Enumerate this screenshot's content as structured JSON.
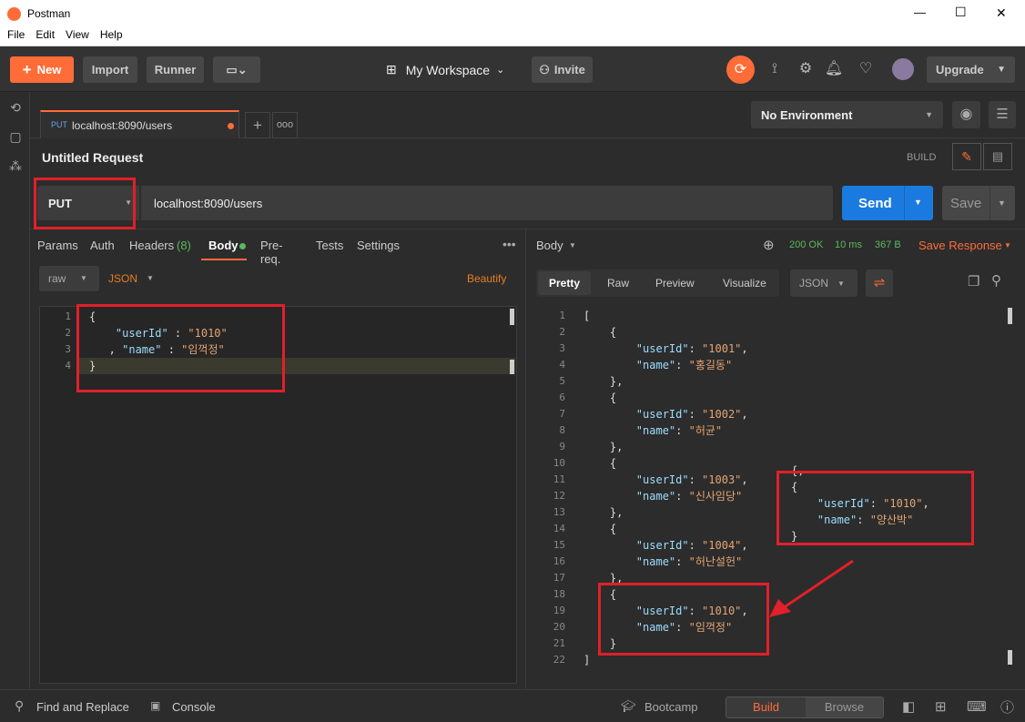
{
  "window": {
    "app_title": "Postman",
    "minimize": "—",
    "maximize": "☐",
    "close": "✕"
  },
  "menu": [
    "File",
    "Edit",
    "View",
    "Help"
  ],
  "header": {
    "new_label": "New",
    "import_label": "Import",
    "runner_label": "Runner",
    "workspace_label": "My Workspace",
    "invite_label": "Invite",
    "upgrade_label": "Upgrade"
  },
  "tab": {
    "method": "PUT",
    "url": "localhost:8090/users"
  },
  "environment": {
    "selected": "No Environment"
  },
  "request": {
    "title": "Untitled Request",
    "build_label": "BUILD",
    "method": "PUT",
    "url": "localhost:8090/users",
    "send_label": "Send",
    "save_label": "Save"
  },
  "request_tabs": {
    "params": "Params",
    "auth": "Auth",
    "headers": "Headers",
    "headers_count": "(8)",
    "body": "Body",
    "prereq": "Pre-req.",
    "tests": "Tests",
    "settings": "Settings"
  },
  "body_options": {
    "raw": "raw",
    "json": "JSON",
    "beautify": "Beautify"
  },
  "request_body": [
    {
      "n": "1",
      "parts": [
        [
          "p",
          "{"
        ]
      ]
    },
    {
      "n": "2",
      "parts": [
        [
          "p",
          "    "
        ],
        [
          "k",
          "\"userId\""
        ],
        [
          "p",
          " : "
        ],
        [
          "s",
          "\"1010\""
        ]
      ]
    },
    {
      "n": "3",
      "parts": [
        [
          "p",
          "   , "
        ],
        [
          "k",
          "\"name\""
        ],
        [
          "p",
          " : "
        ],
        [
          "s",
          "\"임꺽정\""
        ]
      ]
    },
    {
      "n": "4",
      "parts": [
        [
          "p",
          "}"
        ]
      ]
    }
  ],
  "response": {
    "body_label": "Body",
    "status": "200 OK",
    "time": "10 ms",
    "size": "367 B",
    "save_label": "Save Response",
    "views": {
      "pretty": "Pretty",
      "raw": "Raw",
      "preview": "Preview",
      "visualize": "Visualize"
    },
    "format": "JSON"
  },
  "response_body": [
    {
      "n": "1",
      "parts": [
        [
          "p",
          "["
        ]
      ]
    },
    {
      "n": "2",
      "parts": [
        [
          "p",
          "    {"
        ]
      ]
    },
    {
      "n": "3",
      "parts": [
        [
          "p",
          "        "
        ],
        [
          "k",
          "\"userId\""
        ],
        [
          "p",
          ": "
        ],
        [
          "s",
          "\"1001\""
        ],
        [
          "p",
          ","
        ]
      ]
    },
    {
      "n": "4",
      "parts": [
        [
          "p",
          "        "
        ],
        [
          "k",
          "\"name\""
        ],
        [
          "p",
          ": "
        ],
        [
          "s",
          "\"홍길동\""
        ]
      ]
    },
    {
      "n": "5",
      "parts": [
        [
          "p",
          "    },"
        ]
      ]
    },
    {
      "n": "6",
      "parts": [
        [
          "p",
          "    {"
        ]
      ]
    },
    {
      "n": "7",
      "parts": [
        [
          "p",
          "        "
        ],
        [
          "k",
          "\"userId\""
        ],
        [
          "p",
          ": "
        ],
        [
          "s",
          "\"1002\""
        ],
        [
          "p",
          ","
        ]
      ]
    },
    {
      "n": "8",
      "parts": [
        [
          "p",
          "        "
        ],
        [
          "k",
          "\"name\""
        ],
        [
          "p",
          ": "
        ],
        [
          "s",
          "\"허균\""
        ]
      ]
    },
    {
      "n": "9",
      "parts": [
        [
          "p",
          "    },"
        ]
      ]
    },
    {
      "n": "10",
      "parts": [
        [
          "p",
          "    {"
        ]
      ]
    },
    {
      "n": "11",
      "parts": [
        [
          "p",
          "        "
        ],
        [
          "k",
          "\"userId\""
        ],
        [
          "p",
          ": "
        ],
        [
          "s",
          "\"1003\""
        ],
        [
          "p",
          ","
        ]
      ]
    },
    {
      "n": "12",
      "parts": [
        [
          "p",
          "        "
        ],
        [
          "k",
          "\"name\""
        ],
        [
          "p",
          ": "
        ],
        [
          "s",
          "\"신사임당\""
        ]
      ]
    },
    {
      "n": "13",
      "parts": [
        [
          "p",
          "    },"
        ]
      ]
    },
    {
      "n": "14",
      "parts": [
        [
          "p",
          "    {"
        ]
      ]
    },
    {
      "n": "15",
      "parts": [
        [
          "p",
          "        "
        ],
        [
          "k",
          "\"userId\""
        ],
        [
          "p",
          ": "
        ],
        [
          "s",
          "\"1004\""
        ],
        [
          "p",
          ","
        ]
      ]
    },
    {
      "n": "16",
      "parts": [
        [
          "p",
          "        "
        ],
        [
          "k",
          "\"name\""
        ],
        [
          "p",
          ": "
        ],
        [
          "s",
          "\"허난설헌\""
        ]
      ]
    },
    {
      "n": "17",
      "parts": [
        [
          "p",
          "    },"
        ]
      ]
    },
    {
      "n": "18",
      "parts": [
        [
          "p",
          "    {"
        ]
      ]
    },
    {
      "n": "19",
      "parts": [
        [
          "p",
          "        "
        ],
        [
          "k",
          "\"userId\""
        ],
        [
          "p",
          ": "
        ],
        [
          "s",
          "\"1010\""
        ],
        [
          "p",
          ","
        ]
      ]
    },
    {
      "n": "20",
      "parts": [
        [
          "p",
          "        "
        ],
        [
          "k",
          "\"name\""
        ],
        [
          "p",
          ": "
        ],
        [
          "s",
          "\"임꺽정\""
        ]
      ]
    },
    {
      "n": "21",
      "parts": [
        [
          "p",
          "    }"
        ]
      ]
    },
    {
      "n": "22",
      "parts": [
        [
          "p",
          "]"
        ]
      ]
    }
  ],
  "annotation_snippet": [
    {
      "parts": [
        [
          "p",
          "{,"
        ]
      ]
    },
    {
      "parts": [
        [
          "p",
          "{"
        ]
      ]
    },
    {
      "parts": [
        [
          "p",
          "    "
        ],
        [
          "k",
          "\"userId\""
        ],
        [
          "p",
          ": "
        ],
        [
          "s",
          "\"1010\""
        ],
        [
          "p",
          ","
        ]
      ]
    },
    {
      "parts": [
        [
          "p",
          "    "
        ],
        [
          "k",
          "\"name\""
        ],
        [
          "p",
          ": "
        ],
        [
          "s",
          "\"양산박\""
        ]
      ]
    },
    {
      "parts": [
        [
          "p",
          "}"
        ]
      ]
    }
  ],
  "footer": {
    "find_replace": "Find and Replace",
    "console": "Console",
    "bootcamp": "Bootcamp",
    "build": "Build",
    "browse": "Browse"
  },
  "colors": {
    "accent": "#ff6c37",
    "send_blue": "#1b7ae0",
    "status_green": "#5cb85c",
    "annotation_red": "#e0202a"
  }
}
